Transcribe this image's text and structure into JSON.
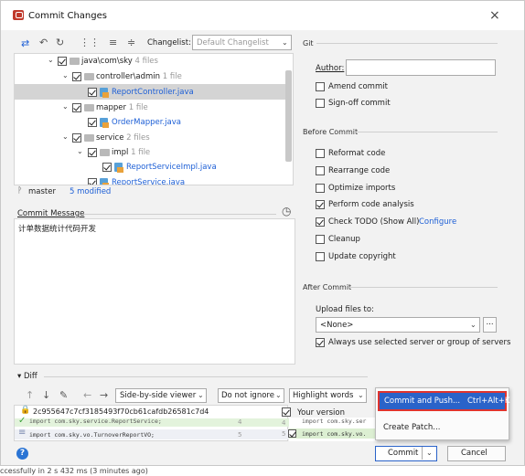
{
  "window": {
    "title": "Commit Changes",
    "close": "×"
  },
  "toolbar": {
    "changelist_label": "Changelist:",
    "changelist_value": "Default Changelist"
  },
  "tree": [
    {
      "name": "java\\com\\sky",
      "count": "4 files"
    },
    {
      "name": "controller\\admin",
      "count": "1 file"
    },
    {
      "name": "ReportController.java",
      "count": ""
    },
    {
      "name": "mapper",
      "count": "1 file"
    },
    {
      "name": "OrderMapper.java",
      "count": ""
    },
    {
      "name": "service",
      "count": "2 files"
    },
    {
      "name": "impl",
      "count": "1 file"
    },
    {
      "name": "ReportServiceImpl.java",
      "count": ""
    },
    {
      "name": "ReportService.java",
      "count": ""
    }
  ],
  "status": {
    "branch": "master",
    "modified": "5 modified"
  },
  "commit_message": {
    "label": "Commit Message",
    "text": "计单数据统计代码开发"
  },
  "git": {
    "header": "Git",
    "author_label": "Author:",
    "author_value": "",
    "amend": "Amend commit",
    "signoff": "Sign-off commit"
  },
  "before_commit": {
    "header": "Before Commit",
    "items": [
      {
        "label": "Reformat code",
        "checked": false
      },
      {
        "label": "Rearrange code",
        "checked": false
      },
      {
        "label": "Optimize imports",
        "checked": false
      },
      {
        "label": "Perform code analysis",
        "checked": true
      },
      {
        "label": "Check TODO (Show All)",
        "checked": true,
        "link": "Configure"
      },
      {
        "label": "Cleanup",
        "checked": false
      },
      {
        "label": "Update copyright",
        "checked": false
      }
    ]
  },
  "after_commit": {
    "header": "After Commit",
    "upload_label": "Upload files to:",
    "upload_value": "<None>",
    "browse": "...",
    "always_use": "Always use selected server or group of servers"
  },
  "diff": {
    "header": "Diff",
    "viewer": "Side-by-side viewer",
    "ignore": "Do not ignore",
    "highlight": "Highlight words",
    "hash": "2c955647c7cf3185493f70cb61cafdb26581c7d4",
    "your_version": "Your version",
    "left_line1": "import com.sky.service.ReportService;",
    "left_line2": "import com.sky.vo.TurnoverReportVO;",
    "num1": "4",
    "num2": "5",
    "rnum1": "4",
    "rnum2": "5",
    "right_line1": "import com.sky.ser",
    "right_line2": "import com.sky.vo."
  },
  "menu": {
    "commit_push": "Commit and Push...",
    "shortcut": "Ctrl+Alt+K",
    "create_patch": "Create Patch..."
  },
  "buttons": {
    "commit": "Commit",
    "cancel": "Cancel",
    "help": "?"
  },
  "footer": "ccessfully in 2 s 432 ms (3 minutes ago)"
}
